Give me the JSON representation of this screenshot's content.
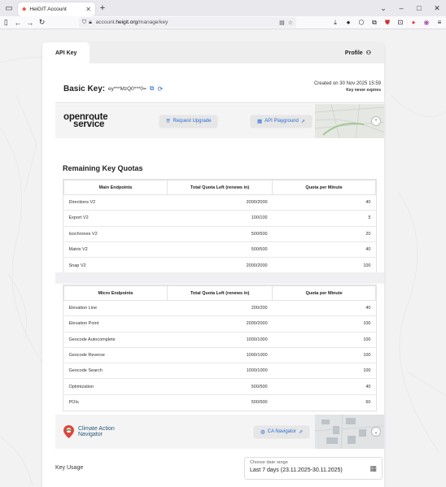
{
  "browser": {
    "tab_title": "HeiGIT Account",
    "url_prefix": "account.",
    "url_host": "heigit.org",
    "url_path": "/manage/key"
  },
  "card": {
    "tab_api_key": "API Key",
    "tab_profile": "Profile"
  },
  "key": {
    "title": "Basic Key:",
    "value": "ey***MzQ0***0=",
    "created": "Created on 30 Nov 2025 15:59",
    "expiry": "Key never expires"
  },
  "ors": {
    "logo_line1": "openroute",
    "logo_line2": "service",
    "request_upgrade": "Request Upgrade",
    "api_playground": "API Playground"
  },
  "quotas": {
    "title": "Remaining Key Quotas",
    "main_headers": [
      "Main Endpoints",
      "Total Quota Left (renews in)",
      "Quota per Minute"
    ],
    "main_rows": [
      [
        "Directions V2",
        "2000/2000",
        "40"
      ],
      [
        "Export V2",
        "100/100",
        "5"
      ],
      [
        "Isochrones V2",
        "500/500",
        "20"
      ],
      [
        "Matrix V2",
        "500/500",
        "40"
      ],
      [
        "Snap V2",
        "2000/2000",
        "100"
      ]
    ],
    "micro_headers": [
      "Micro Endpoints",
      "Total Quota Left (renews in)",
      "Quota per Minute"
    ],
    "micro_rows": [
      [
        "Elevation Line",
        "200/200",
        "40"
      ],
      [
        "Elevation Point",
        "2000/2000",
        "100"
      ],
      [
        "Geocode Autocomplete",
        "1000/1000",
        "100"
      ],
      [
        "Geocode Reverse",
        "1000/1000",
        "100"
      ],
      [
        "Geocode Search",
        "1000/1000",
        "100"
      ],
      [
        "Optimization",
        "500/500",
        "40"
      ],
      [
        "POIs",
        "500/500",
        "60"
      ]
    ]
  },
  "can": {
    "logo_line1": "Climate Action",
    "logo_line2": "Navigator",
    "button": "CA Navigator"
  },
  "usage": {
    "label": "Key Usage",
    "date_label": "Choose date range",
    "date_value": "Last 7 days (23.11.2025-30.11.2025)"
  },
  "colors": {
    "accent": "#2a6fd6",
    "brand_red": "#e0443a"
  }
}
